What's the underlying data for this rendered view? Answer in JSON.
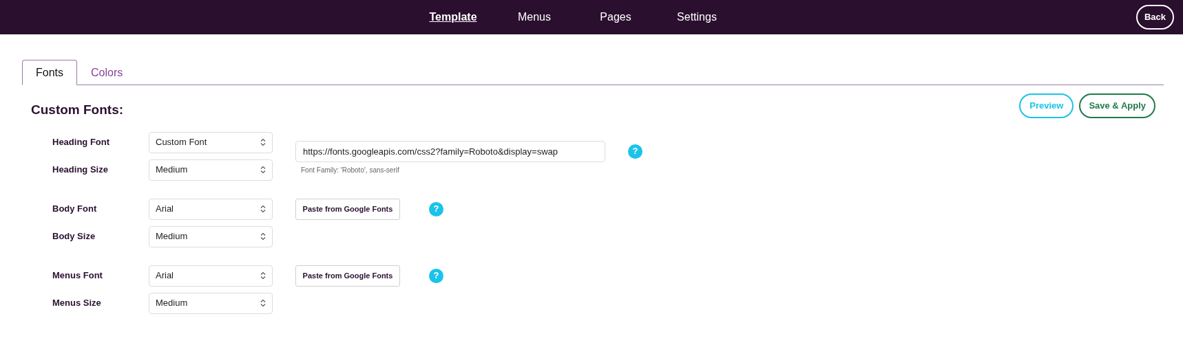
{
  "nav": {
    "items": [
      {
        "label": "Template",
        "selected": true
      },
      {
        "label": "Menus",
        "selected": false
      },
      {
        "label": "Pages",
        "selected": false
      },
      {
        "label": "Settings",
        "selected": false
      }
    ],
    "back": "Back"
  },
  "tabs": [
    {
      "label": "Fonts",
      "selected": true
    },
    {
      "label": "Colors",
      "selected": false
    }
  ],
  "heading": "Custom Fonts:",
  "actions": {
    "preview": "Preview",
    "save": "Save & Apply"
  },
  "groups": [
    {
      "font_label": "Heading Font",
      "font_value": "Custom Font",
      "size_label": "Heading Size",
      "size_value": "Medium",
      "aside": {
        "kind": "url",
        "value": "https://fonts.googleapis.com/css2?family=Roboto&display=swap",
        "hint": "Font Family: 'Roboto', sans-serif",
        "help": "?"
      }
    },
    {
      "font_label": "Body Font",
      "font_value": "Arial",
      "size_label": "Body Size",
      "size_value": "Medium",
      "aside": {
        "kind": "paste",
        "label": "Paste from Google Fonts",
        "help": "?"
      }
    },
    {
      "font_label": "Menus Font",
      "font_value": "Arial",
      "size_label": "Menus Size",
      "size_value": "Medium",
      "aside": {
        "kind": "paste",
        "label": "Paste from Google Fonts",
        "help": "?"
      }
    }
  ]
}
